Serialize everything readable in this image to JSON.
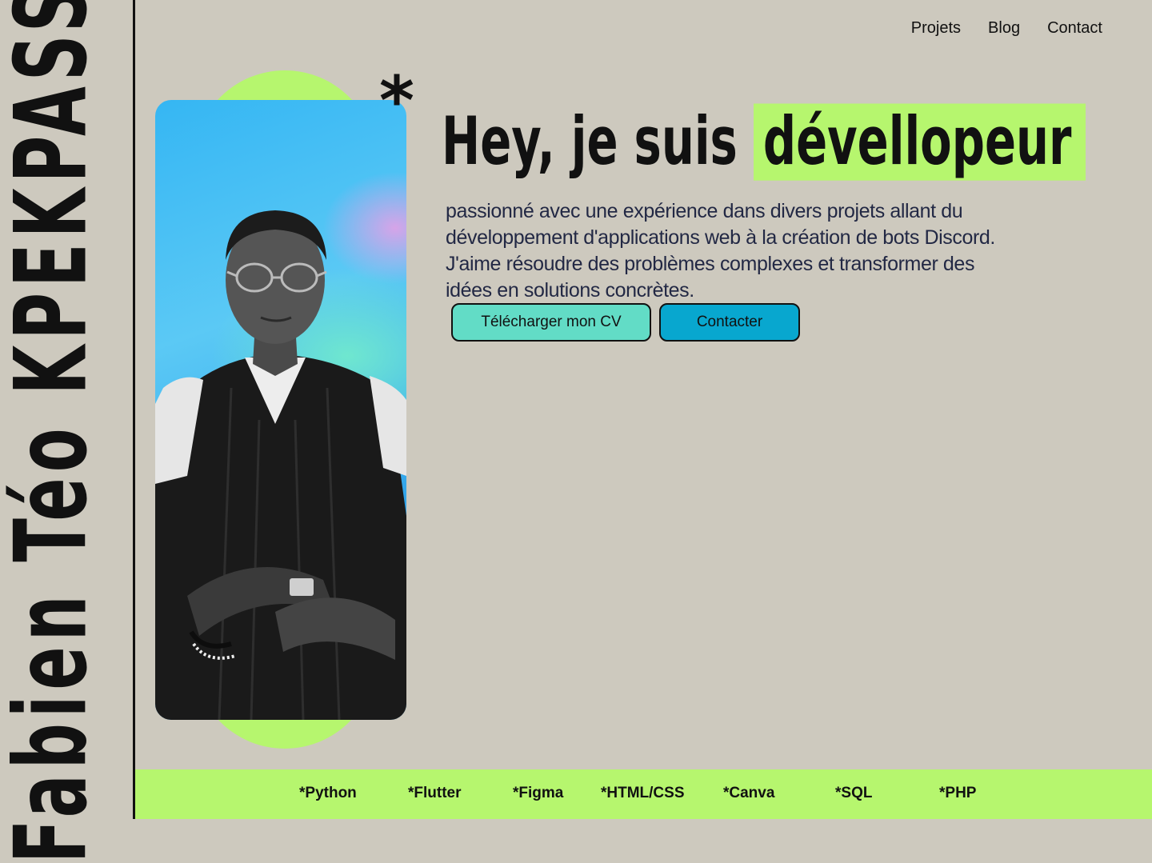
{
  "sidebar": {
    "name": "Fabien Téo KPEKPASSI"
  },
  "nav": {
    "items": [
      "Projets",
      "Blog",
      "Contact"
    ]
  },
  "hero": {
    "asterisk": "*",
    "headline_prefix": "Hey, je suis",
    "headline_highlight": "dévellopeur",
    "bio": "passionné avec une expérience dans divers projets allant du développement d'applications web à la création de bots Discord. J'aime résoudre des problèmes complexes et transformer des idées en solutions concrètes.",
    "cv_button": "Télécharger mon CV",
    "contact_button": "Contacter"
  },
  "skills": [
    "*Python",
    "*Flutter",
    "*Figma",
    "*HTML/CSS",
    "*Canva",
    "*SQL",
    "*PHP"
  ],
  "colors": {
    "background": "#cdc9be",
    "accent_green": "#b6f66e",
    "cv_button": "#62dcc6",
    "contact_button": "#08a7cf",
    "text_dark": "#111111",
    "bio_text": "#222844"
  },
  "icons": {
    "photo": "profile-photo"
  }
}
